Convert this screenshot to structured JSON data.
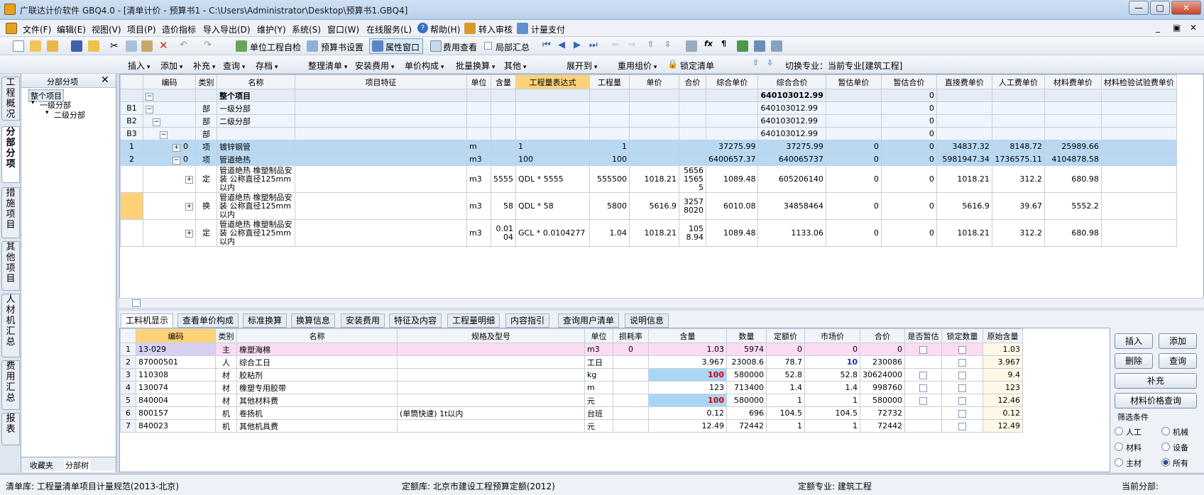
{
  "window": {
    "title": "广联达计价软件 GBQ4.0 - [清单计价 - 预算书1 - C:\\Users\\Administrator\\Desktop\\预算书1.GBQ4]",
    "min": "—",
    "max": "□",
    "close": "✕"
  },
  "menu": [
    "文件(F)",
    "编辑(E)",
    "视图(V)",
    "项目(P)",
    "造价指标",
    "导入导出(D)",
    "维护(Y)",
    "系统(S)",
    "窗口(W)",
    "在线服务(L)",
    "帮助(H)",
    "转入审核",
    "计量支付"
  ],
  "toolbar1": {
    "check": "单位工程自检",
    "setup": "预算书设置",
    "attr": "属性窗口",
    "feeview": "费用查看",
    "partial": "局部汇总"
  },
  "toolbar2": {
    "insert": "插入",
    "add": "添加",
    "supplement": "补充",
    "query": "查询",
    "store": "存档",
    "org": "整理清单",
    "install": "安装费用",
    "unitcomp": "单价构成",
    "batch": "批量换算",
    "other": "其他",
    "expand": "展开到",
    "reuse": "重用组价",
    "lock": "锁定清单",
    "switch": "切换专业：当前专业[建筑工程]"
  },
  "lefttabs": [
    "工程概况",
    "分部分项",
    "措施项目",
    "其他项目",
    "人材机汇总",
    "费用汇总",
    "报表"
  ],
  "tree": {
    "header": "分部分项",
    "close": "✕",
    "root": "整个项目",
    "l1": "一级分部",
    "l2": "二级分部",
    "tab1": "收藏夹",
    "tab2": "分部树"
  },
  "grid": {
    "headers": [
      "",
      "编码",
      "类别",
      "名称",
      "项目特征",
      "单位",
      "含量",
      "工程量表达式",
      "工程量",
      "单价",
      "合价",
      "综合单价",
      "综合合价",
      "暂估单价",
      "暂估合价",
      "直接费单价",
      "人工费单价",
      "材料费单价",
      "材料检验试验费单价"
    ],
    "rows": [
      {
        "no": "",
        "code": "",
        "type": "",
        "name": "整个项目",
        "unit": "",
        "qty_ratio": "",
        "expr": "",
        "qty": "",
        "price": "",
        "total": "",
        "cprice": "",
        "ctotal": "640103012.99",
        "eprice": "",
        "etotal": "0",
        "dprice": "",
        "lprice": "",
        "mprice": ""
      },
      {
        "no": "B1",
        "code": "",
        "type": "部",
        "name": "一级分部",
        "unit": "",
        "qty_ratio": "",
        "expr": "",
        "qty": "",
        "price": "",
        "total": "",
        "cprice": "",
        "ctotal": "640103012.99",
        "eprice": "",
        "etotal": "0",
        "dprice": "",
        "lprice": "",
        "mprice": ""
      },
      {
        "no": "B2",
        "code": "",
        "type": "部",
        "name": "二级分部",
        "unit": "",
        "qty_ratio": "",
        "expr": "",
        "qty": "",
        "price": "",
        "total": "",
        "cprice": "",
        "ctotal": "640103012.99",
        "eprice": "",
        "etotal": "0",
        "dprice": "",
        "lprice": "",
        "mprice": ""
      },
      {
        "no": "B3",
        "code": "",
        "type": "部",
        "name": "",
        "unit": "",
        "qty_ratio": "",
        "expr": "",
        "qty": "",
        "price": "",
        "total": "",
        "cprice": "",
        "ctotal": "640103012.99",
        "eprice": "",
        "etotal": "0",
        "dprice": "",
        "lprice": "",
        "mprice": ""
      },
      {
        "no": "1",
        "code": "0",
        "type": "项",
        "name": "镀锌钢管",
        "unit": "m",
        "qty_ratio": "",
        "expr": "1",
        "qty": "1",
        "price": "",
        "total": "",
        "cprice": "37275.99",
        "ctotal": "37275.99",
        "eprice": "0",
        "etotal": "0",
        "dprice": "34837.32",
        "lprice": "8148.72",
        "mprice": "25989.66"
      },
      {
        "no": "2",
        "code": "0",
        "type": "项",
        "name": "管道绝热",
        "unit": "m3",
        "qty_ratio": "",
        "expr": "100",
        "qty": "100",
        "price": "",
        "total": "",
        "cprice": "6400657.37",
        "ctotal": "640065737",
        "eprice": "0",
        "etotal": "0",
        "dprice": "5981947.34",
        "lprice": "1736575.11",
        "mprice": "4104878.58"
      },
      {
        "no": "",
        "code": "",
        "type": "定",
        "name": "管道绝热 橡塑制品安装 公称直径125mm以内",
        "unit": "m3",
        "qty_ratio": "5555",
        "expr": "QDL * 5555",
        "qty": "555500",
        "price": "1018.21",
        "total": "565615655",
        "cprice": "1089.48",
        "ctotal": "605206140",
        "eprice": "0",
        "etotal": "0",
        "dprice": "1018.21",
        "lprice": "312.2",
        "mprice": "680.98"
      },
      {
        "no": "",
        "code": "",
        "type": "换",
        "name": "管道绝热 橡塑制品安装 公称直径125mm以内",
        "unit": "m3",
        "qty_ratio": "58",
        "expr": "QDL * 58",
        "qty": "5800",
        "price": "5616.9",
        "total": "32578020",
        "cprice": "6010.08",
        "ctotal": "34858464",
        "eprice": "0",
        "etotal": "0",
        "dprice": "5616.9",
        "lprice": "39.67",
        "mprice": "5552.2"
      },
      {
        "no": "",
        "code": "",
        "type": "定",
        "name": "管道绝热 橡塑制品安装 公称直径125mm以内",
        "unit": "m3",
        "qty_ratio": "0.0104",
        "expr": "GCL * 0.0104277",
        "qty": "1.04",
        "price": "1018.21",
        "total": "1058.94",
        "cprice": "1089.48",
        "ctotal": "1133.06",
        "eprice": "0",
        "etotal": "0",
        "dprice": "1018.21",
        "lprice": "312.2",
        "mprice": "680.98"
      }
    ]
  },
  "bottomtabs": [
    "工料机显示",
    "查看单价构成",
    "标准换算",
    "换算信息",
    "安装费用",
    "特征及内容",
    "工程量明细",
    "内容指引",
    "查询用户清单",
    "说明信息"
  ],
  "bgrid": {
    "headers": [
      "",
      "编码",
      "类别",
      "名称",
      "规格及型号",
      "单位",
      "损耗率",
      "含量",
      "数量",
      "定额价",
      "市场价",
      "合价",
      "是否暂估",
      "锁定数量",
      "原始含量"
    ],
    "rows": [
      {
        "no": "1",
        "code": "13-029",
        "type": "主",
        "name": "橡塑海棉",
        "spec": "",
        "unit": "m3",
        "loss": "0",
        "ratio": "1.03",
        "qty": "5974",
        "dprice": "0",
        "mprice": "0",
        "total": "0",
        "est": true,
        "lock": true,
        "orig": "1.03"
      },
      {
        "no": "2",
        "code": "87000501",
        "type": "人",
        "name": "综合工日",
        "spec": "",
        "unit": "工日",
        "loss": "",
        "ratio": "3.967",
        "qty": "23008.6",
        "dprice": "78.7",
        "mprice": "10",
        "total": "230086",
        "est": false,
        "lock": true,
        "orig": "3.967"
      },
      {
        "no": "3",
        "code": "110308",
        "type": "材",
        "name": "胶粘剂",
        "spec": "",
        "unit": "kg",
        "loss": "",
        "ratio": "100",
        "qty": "580000",
        "dprice": "52.8",
        "mprice": "52.8",
        "total": "30624000",
        "est": true,
        "lock": true,
        "orig": "9.4"
      },
      {
        "no": "4",
        "code": "130074",
        "type": "材",
        "name": "橡塑专用胶带",
        "spec": "",
        "unit": "m",
        "loss": "",
        "ratio": "123",
        "qty": "713400",
        "dprice": "1.4",
        "mprice": "1.4",
        "total": "998760",
        "est": true,
        "lock": true,
        "orig": "123"
      },
      {
        "no": "5",
        "code": "840004",
        "type": "材",
        "name": "其他材料费",
        "spec": "",
        "unit": "元",
        "loss": "",
        "ratio": "100",
        "qty": "580000",
        "dprice": "1",
        "mprice": "1",
        "total": "580000",
        "est": true,
        "lock": true,
        "orig": "12.46"
      },
      {
        "no": "6",
        "code": "800157",
        "type": "机",
        "name": "卷扬机",
        "spec": "(单筒快速) 1t以内",
        "unit": "台班",
        "loss": "",
        "ratio": "0.12",
        "qty": "696",
        "dprice": "104.5",
        "mprice": "104.5",
        "total": "72732",
        "est": false,
        "lock": true,
        "orig": "0.12"
      },
      {
        "no": "7",
        "code": "840023",
        "type": "机",
        "name": "其他机具费",
        "spec": "",
        "unit": "元",
        "loss": "",
        "ratio": "12.49",
        "qty": "72442",
        "dprice": "1",
        "mprice": "1",
        "total": "72442",
        "est": false,
        "lock": true,
        "orig": "12.49"
      }
    ]
  },
  "rightpanel": {
    "insert": "插入",
    "add": "添加",
    "delete": "删除",
    "query": "查询",
    "supp": "补充",
    "pricequery": "材料价格查询",
    "filter": "筛选条件",
    "r1": "人工",
    "r2": "机械",
    "r3": "材料",
    "r4": "设备",
    "r5": "主材",
    "r6": "所有"
  },
  "status": {
    "lib": "清单库:  工程量清单项目计量规范(2013-北京)",
    "quota": "定额库:  北京市建设工程预算定额(2012)",
    "major": "定额专业:  建筑工程",
    "current": "当前分部:"
  }
}
